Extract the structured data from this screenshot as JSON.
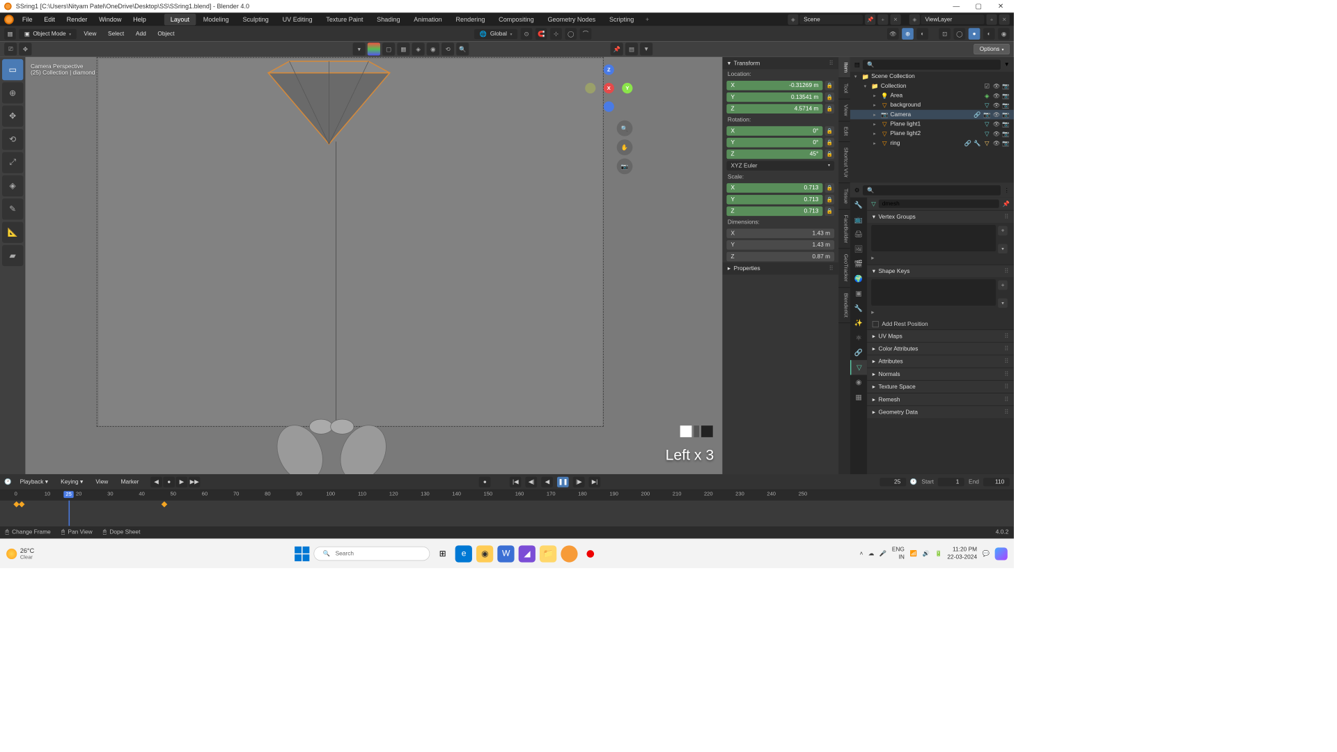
{
  "title": "SSring1 [C:\\Users\\Nityam Patel\\OneDrive\\Desktop\\SS\\SSring1.blend] - Blender 4.0",
  "topmenu": {
    "file": "File",
    "edit": "Edit",
    "render": "Render",
    "window": "Window",
    "help": "Help",
    "tabs": [
      "Layout",
      "Modeling",
      "Sculpting",
      "UV Editing",
      "Texture Paint",
      "Shading",
      "Animation",
      "Rendering",
      "Compositing",
      "Geometry Nodes",
      "Scripting"
    ],
    "active_tab": 0,
    "scene": "Scene",
    "viewlayer": "ViewLayer"
  },
  "toolbar": {
    "mode": "Object Mode",
    "view": "View",
    "select": "Select",
    "add": "Add",
    "object": "Object",
    "orient": "Global"
  },
  "subtool": {
    "options": "Options"
  },
  "viewport": {
    "cam": "Camera Perspective",
    "info": "(25) Collection | diamond",
    "leftx": "Left x 3"
  },
  "npanel": {
    "transform": "Transform",
    "location": "Location:",
    "rotation": "Rotation:",
    "scale": "Scale:",
    "dims": "Dimensions:",
    "loc": {
      "x": "-0.31269 m",
      "y": "0.13541 m",
      "z": "4.5714 m"
    },
    "rot": {
      "x": "0°",
      "y": "0°",
      "z": "45°"
    },
    "rotmode": "XYZ Euler",
    "scl": {
      "x": "0.713",
      "y": "0.713",
      "z": "0.713"
    },
    "dim": {
      "x": "1.43 m",
      "y": "1.43 m",
      "z": "0.87 m"
    },
    "properties": "Properties",
    "tabs": [
      "Item",
      "Tool",
      "View",
      "Edit",
      "Shortcut VUr",
      "Tissue",
      "FaceBuilder",
      "GeoTracker",
      "BlenderKit"
    ]
  },
  "outliner": {
    "root": "Scene Collection",
    "coll": "Collection",
    "items": [
      {
        "name": "Area",
        "type": "light"
      },
      {
        "name": "background",
        "type": "mesh"
      },
      {
        "name": "Camera",
        "type": "cam"
      },
      {
        "name": "Plane light1",
        "type": "mesh"
      },
      {
        "name": "Plane light2",
        "type": "mesh"
      },
      {
        "name": "ring",
        "type": "mesh"
      }
    ]
  },
  "props": {
    "obj": "dmesh",
    "vgroups": "Vertex Groups",
    "shapekeys": "Shape Keys",
    "addrest": "Add Rest Position",
    "uvmaps": "UV Maps",
    "colorattr": "Color Attributes",
    "attrs": "Attributes",
    "normals": "Normals",
    "texspace": "Texture Space",
    "remesh": "Remesh",
    "geodata": "Geometry Data"
  },
  "timeline": {
    "playback": "Playback",
    "keying": "Keying",
    "view": "View",
    "marker": "Marker",
    "cur": "25",
    "start_l": "Start",
    "start": "1",
    "end_l": "End",
    "end": "110",
    "ticks": [
      0,
      10,
      20,
      30,
      40,
      50,
      60,
      70,
      80,
      90,
      100,
      110,
      120,
      130,
      140,
      150,
      160,
      170,
      180,
      190,
      200,
      210,
      220,
      230,
      240,
      250
    ]
  },
  "status": {
    "change": "Change Frame",
    "pan": "Pan View",
    "dope": "Dope Sheet",
    "ver": "4.0.2"
  },
  "task": {
    "temp": "26°C",
    "cond": "Clear",
    "search": "Search",
    "lang": "ENG",
    "loc": "IN",
    "time": "11:20 PM",
    "date": "22-03-2024"
  }
}
